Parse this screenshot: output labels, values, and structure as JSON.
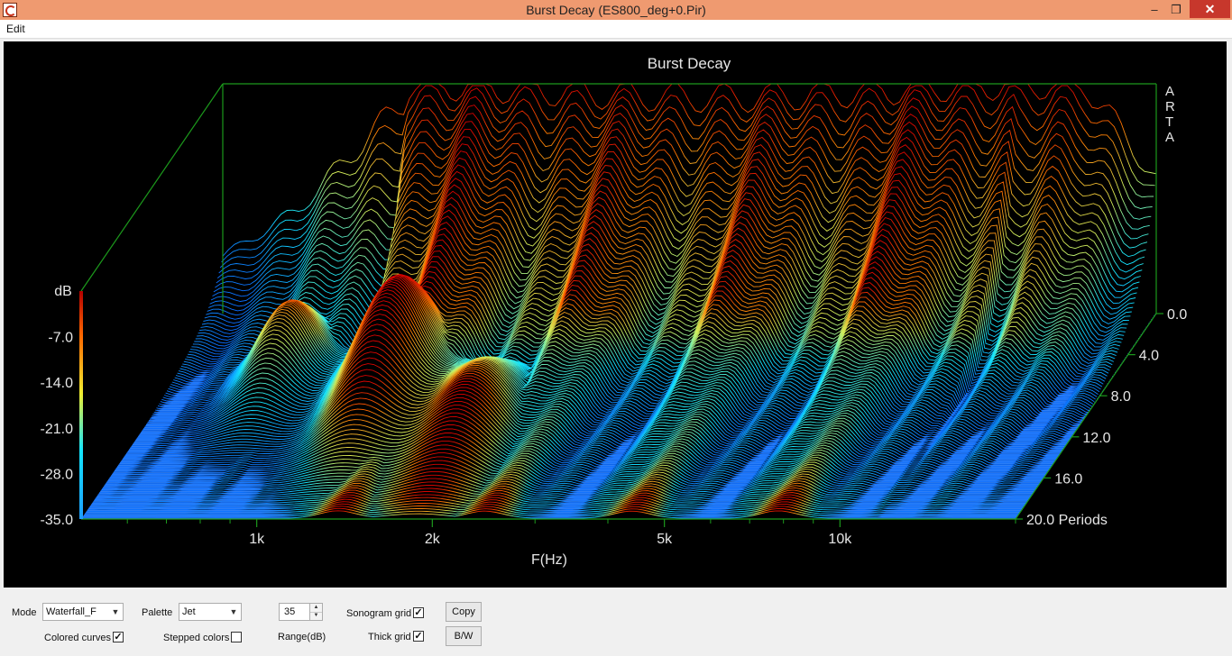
{
  "window": {
    "title": "Burst Decay  (ES800_deg+0.Pir)",
    "minimize_glyph": "–",
    "restore_glyph": "❐",
    "close_glyph": "✕"
  },
  "menu": {
    "items": [
      "Edit"
    ]
  },
  "chart_data": {
    "type": "waterfall",
    "title": "Burst Decay",
    "watermark": "ARTA",
    "xlabel": "F(Hz)",
    "ylabel": "dB",
    "zlabel": "Periods",
    "x_scale": "log",
    "x_ticks": [
      "1k",
      "2k",
      "5k",
      "10k"
    ],
    "y_ticks": [
      "-7.0",
      "-14.0",
      "-21.0",
      "-28.0",
      "-35.0"
    ],
    "z_ticks": [
      "0.0",
      "4.0",
      "8.0",
      "12.0",
      "16.0",
      "20.0"
    ],
    "y_range": [
      -35,
      0
    ],
    "z_range": [
      0,
      20
    ],
    "palette": "Jet"
  },
  "controls": {
    "mode_label": "Mode",
    "mode_value": "Waterfall_F",
    "palette_label": "Palette",
    "palette_value": "Jet",
    "range_value": "35",
    "range_label": "Range(dB)",
    "sonogram_grid_label": "Sonogram grid",
    "sonogram_grid_checked": "✓",
    "thick_grid_label": "Thick grid",
    "thick_grid_checked": "✓",
    "colored_curves_label": "Colored curves",
    "colored_curves_checked": "✓",
    "stepped_colors_label": "Stepped colors",
    "stepped_colors_checked": "",
    "copy_label": "Copy",
    "bw_label": "B/W"
  },
  "colors": {
    "titlebar": "#ef9a70",
    "plot_background": "#000000",
    "grid": "#1c9a1c",
    "floor": "#2f7ff5"
  }
}
